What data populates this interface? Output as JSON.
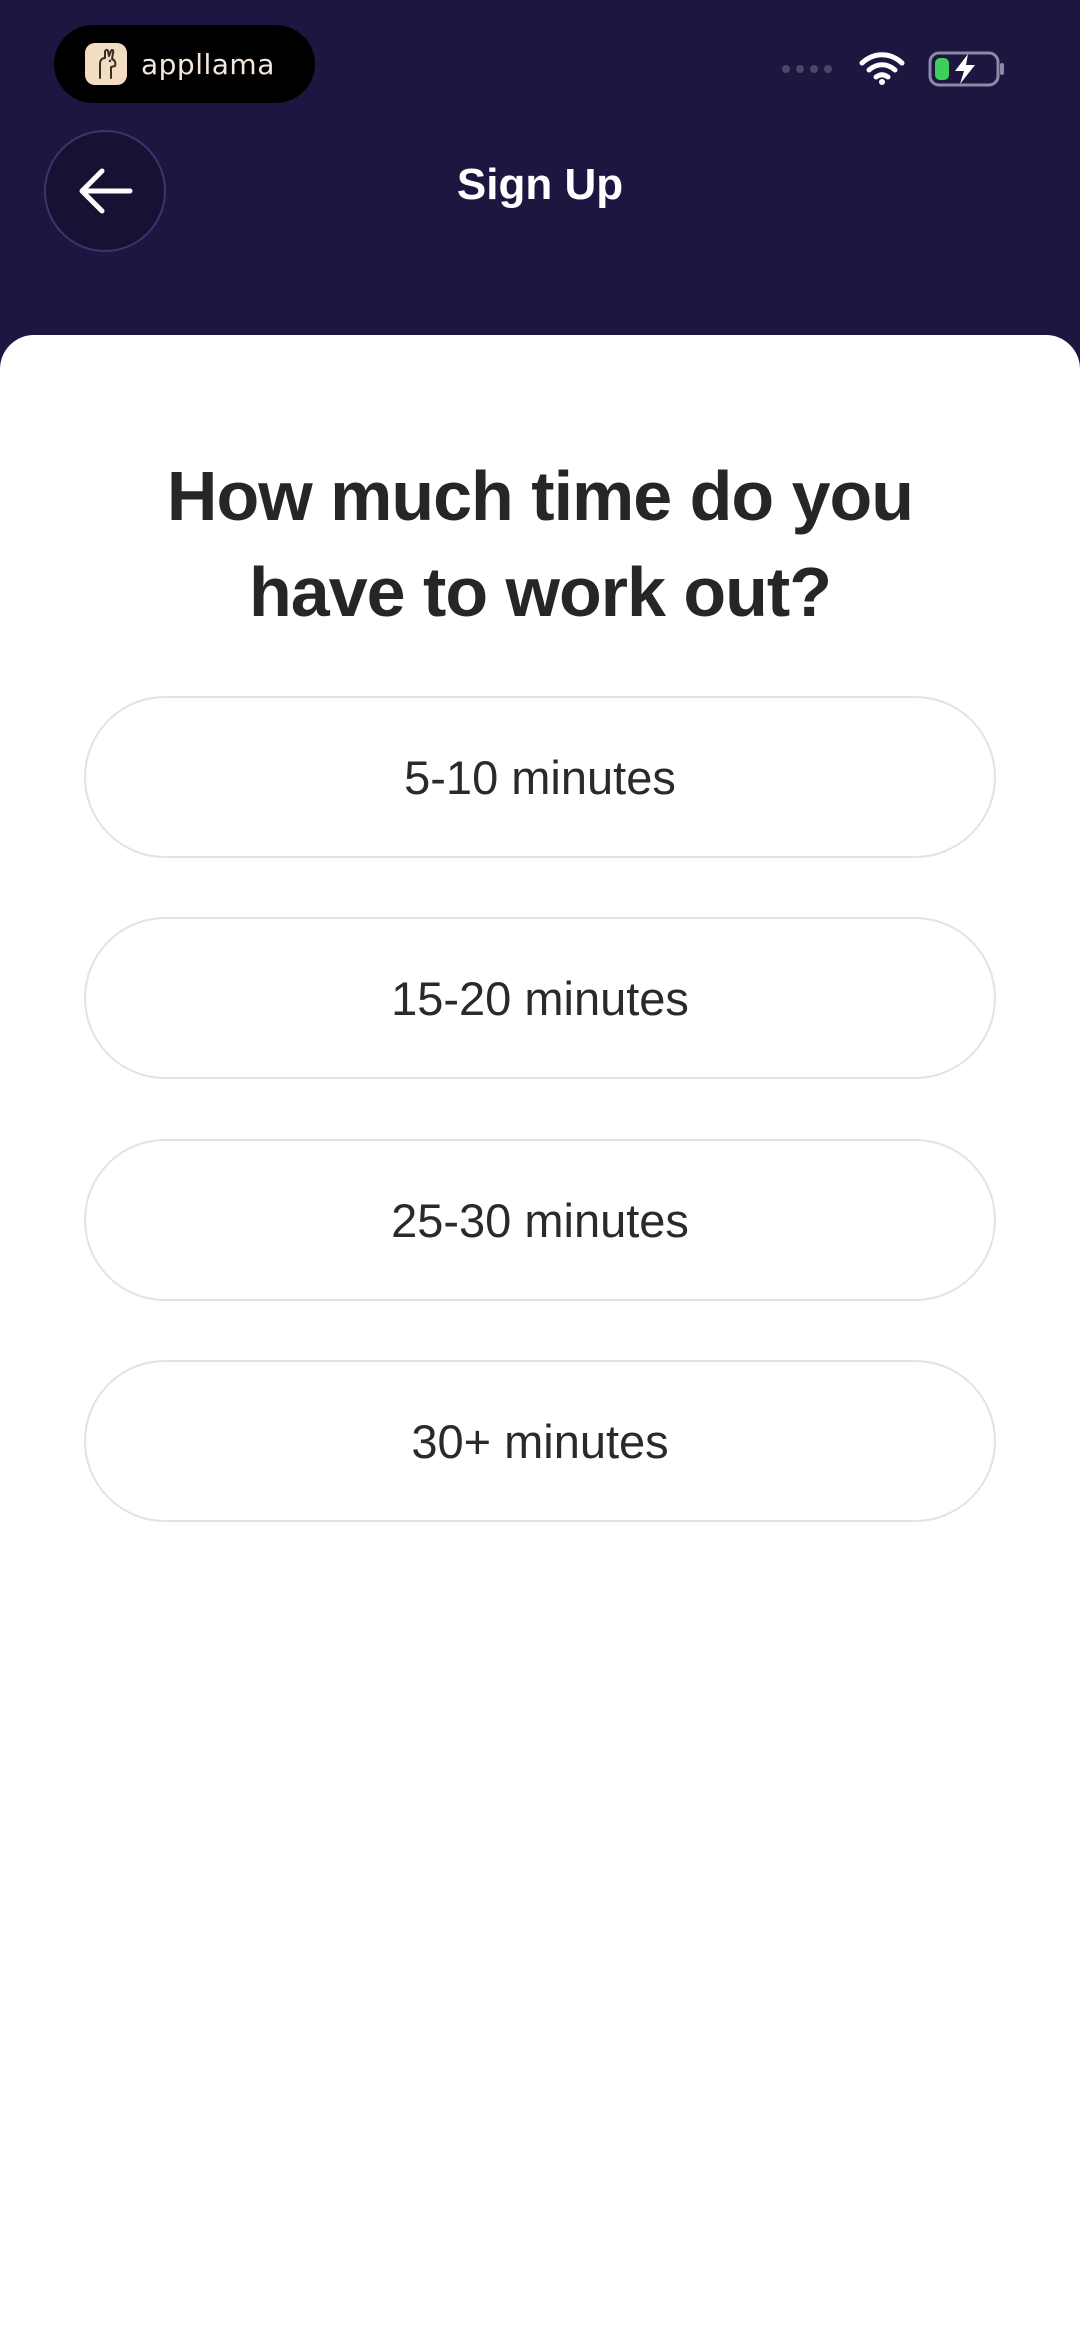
{
  "status_bar": {
    "app_pill_label": "appllama",
    "app_pill_icon": "llama-logo-icon",
    "wifi_icon": "wifi-icon",
    "battery_icon": "battery-charging-icon",
    "battery_fill_color": "#3ecf5a"
  },
  "header": {
    "back_icon": "arrow-left-icon",
    "title": "Sign Up",
    "background_color": "#1c1640"
  },
  "question": {
    "line1": "How much time do you",
    "line2": "have to work out?"
  },
  "options": [
    {
      "label": "5-10 minutes"
    },
    {
      "label": "15-20 minutes"
    },
    {
      "label": "25-30 minutes"
    },
    {
      "label": "30+ minutes"
    }
  ]
}
